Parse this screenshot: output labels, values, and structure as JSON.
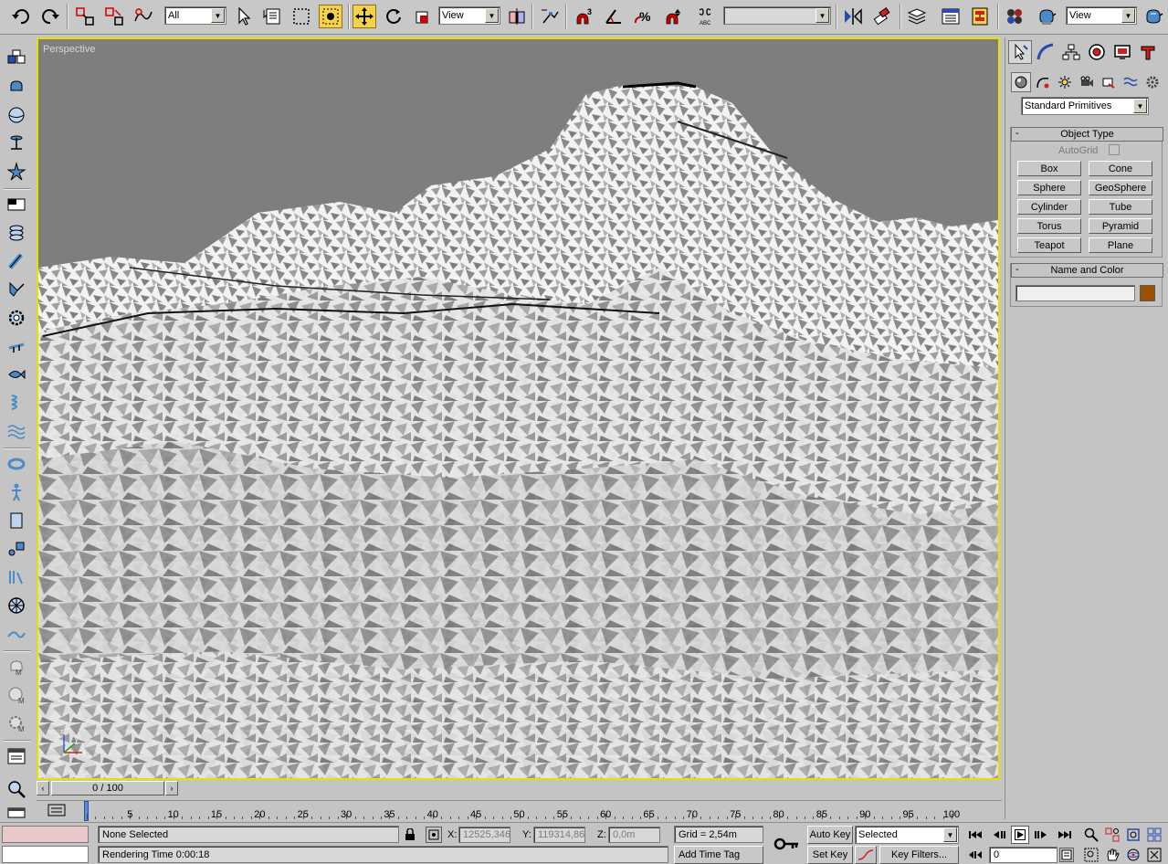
{
  "toolbar": {
    "selection_filter": "All",
    "reference_coord": "View",
    "named_selection": "",
    "render_dropdown": "View",
    "icons": [
      "undo-icon",
      "redo-icon",
      "select-and-link-icon",
      "unlink-icon",
      "bind-space-warp-icon",
      "select-object-icon",
      "select-by-name-icon",
      "rect-selection-icon",
      "window-crossing-icon",
      "select-move-icon",
      "select-rotate-icon",
      "select-scale-icon",
      "use-pivot-center-icon",
      "select-manipulate-icon",
      "snaps-toggle-icon",
      "angle-snap-icon",
      "percent-snap-icon",
      "spinner-snap-icon",
      "edit-named-selection-icon",
      "mirror-icon",
      "align-icon",
      "layer-manager-icon",
      "curve-editor-icon",
      "schematic-view-icon",
      "material-editor-icon",
      "render-scene-icon",
      "quick-render-icon"
    ]
  },
  "viewport": {
    "label": "Perspective"
  },
  "command_panel": {
    "category_dropdown": "Standard Primitives",
    "object_type": {
      "title": "Object Type",
      "collapse": "-",
      "autogrid_label": "AutoGrid",
      "buttons": [
        "Box",
        "Cone",
        "Sphere",
        "GeoSphere",
        "Cylinder",
        "Tube",
        "Torus",
        "Pyramid",
        "Teapot",
        "Plane"
      ]
    },
    "name_and_color": {
      "title": "Name and Color",
      "collapse": "-",
      "name_value": "",
      "color": "#9a5200"
    }
  },
  "timeline": {
    "slider_label": "0 / 100",
    "ticks": [
      "5",
      "10",
      "15",
      "20",
      "25",
      "30",
      "35",
      "40",
      "45",
      "50",
      "55",
      "60",
      "65",
      "70",
      "75",
      "80",
      "85",
      "90",
      "95",
      "100"
    ]
  },
  "statusbar": {
    "selection_status": "None Selected",
    "rendering_time": "Rendering Time  0:00:18",
    "x_label": "X:",
    "x_value": "12525,346",
    "y_label": "Y:",
    "y_value": "119314,86",
    "z_label": "Z:",
    "z_value": "0,0m",
    "grid": "Grid = 2,54m",
    "add_time_tag": "Add Time Tag",
    "auto_key": "Auto Key",
    "set_key": "Set Key",
    "key_mode_dropdown": "Selected",
    "key_filters": "Key Filters...",
    "current_frame": "0"
  }
}
